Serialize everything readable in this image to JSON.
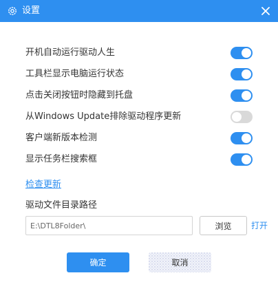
{
  "window": {
    "title": "设置",
    "title_icon": "gear-icon",
    "close_icon": "close-icon",
    "accent_color": "#2e8ff0"
  },
  "settings": [
    {
      "label": "开机自动运行驱动人生",
      "enabled": true
    },
    {
      "label": "工具栏显示电脑运行状态",
      "enabled": true
    },
    {
      "label": "点击关闭按钮时隐藏到托盘",
      "enabled": true
    },
    {
      "label": "从Windows Update排除驱动程序更新",
      "enabled": false
    },
    {
      "label": "客户端新版本检测",
      "enabled": true
    },
    {
      "label": "显示任务栏搜索框",
      "enabled": true
    }
  ],
  "check_update_label": "检查更新",
  "driver_path": {
    "label": "驱动文件目录路径",
    "value": "E:\\DTL8Folder\\",
    "browse_label": "浏览",
    "open_label": "打开"
  },
  "buttons": {
    "ok_label": "确定",
    "cancel_label": "取消"
  }
}
